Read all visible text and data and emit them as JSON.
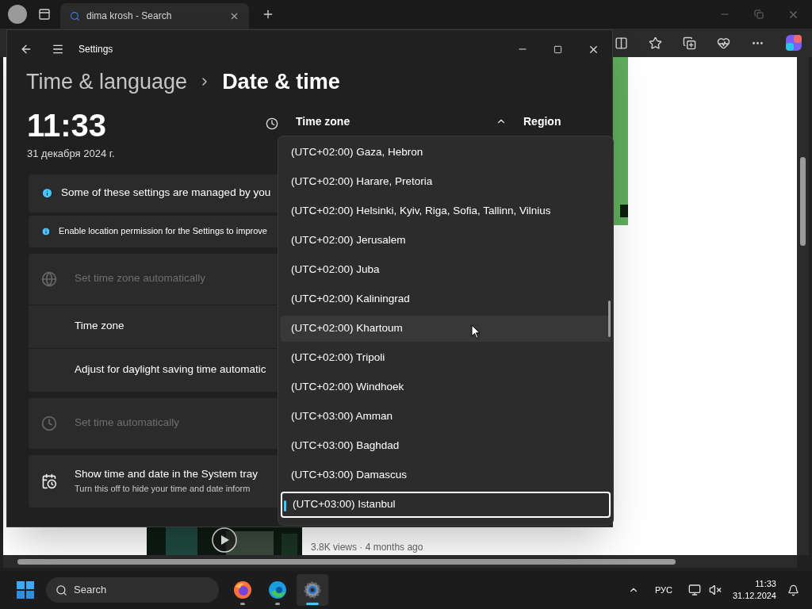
{
  "browser": {
    "tabs": [
      {
        "label": "dima krosh - Search",
        "selected": true
      }
    ],
    "page_caption": "3.8K views · 4 months ago"
  },
  "settings": {
    "title": "Settings",
    "breadcrumb": {
      "parent": "Time & language",
      "current": "Date & time"
    },
    "clock": {
      "time": "11:33",
      "date": "31 декабря 2024 г."
    },
    "section_headers": [
      "Time zone",
      "Region"
    ],
    "notices": [
      {
        "text": "Some of these settings are managed by you",
        "kind": "banner"
      },
      {
        "text": "Enable location permission for the Settings to improve",
        "kind": "hint"
      }
    ],
    "cards": [
      {
        "rows": [
          {
            "label": "Set time zone automatically",
            "disabled": true
          },
          {
            "label": "Time zone",
            "disabled": false
          },
          {
            "label": "Adjust for daylight saving time automatic",
            "disabled": false
          }
        ]
      },
      {
        "rows": [
          {
            "label": "Set time automatically",
            "disabled": true
          }
        ]
      },
      {
        "rows": [
          {
            "label": "Show time and date in the System tray",
            "subtitle": "Turn this off to hide your time and date inform",
            "disabled": false
          }
        ]
      }
    ],
    "timezone_dropdown": {
      "options": [
        {
          "label": "(UTC+02:00) Gaza, Hebron",
          "selected": false,
          "hovered": false
        },
        {
          "label": "(UTC+02:00) Harare, Pretoria",
          "selected": false,
          "hovered": false
        },
        {
          "label": "(UTC+02:00) Helsinki, Kyiv, Riga, Sofia, Tallinn, Vilnius",
          "selected": false,
          "hovered": false
        },
        {
          "label": "(UTC+02:00) Jerusalem",
          "selected": false,
          "hovered": false
        },
        {
          "label": "(UTC+02:00) Juba",
          "selected": false,
          "hovered": false
        },
        {
          "label": "(UTC+02:00) Kaliningrad",
          "selected": false,
          "hovered": false
        },
        {
          "label": "(UTC+02:00) Khartoum",
          "selected": false,
          "hovered": true
        },
        {
          "label": "(UTC+02:00) Tripoli",
          "selected": false,
          "hovered": false
        },
        {
          "label": "(UTC+02:00) Windhoek",
          "selected": false,
          "hovered": false
        },
        {
          "label": "(UTC+03:00) Amman",
          "selected": false,
          "hovered": false
        },
        {
          "label": "(UTC+03:00) Baghdad",
          "selected": false,
          "hovered": false
        },
        {
          "label": "(UTC+03:00) Damascus",
          "selected": false,
          "hovered": false
        },
        {
          "label": "(UTC+03:00) Istanbul",
          "selected": true,
          "hovered": false
        }
      ]
    }
  },
  "taskbar": {
    "search_placeholder": "Search",
    "apps": [
      {
        "kind": "firefox",
        "active": false
      },
      {
        "kind": "edge",
        "active": false
      },
      {
        "kind": "settings",
        "active": true
      }
    ],
    "language": "РУС",
    "time": "11:33",
    "date": "31.12.2024"
  }
}
